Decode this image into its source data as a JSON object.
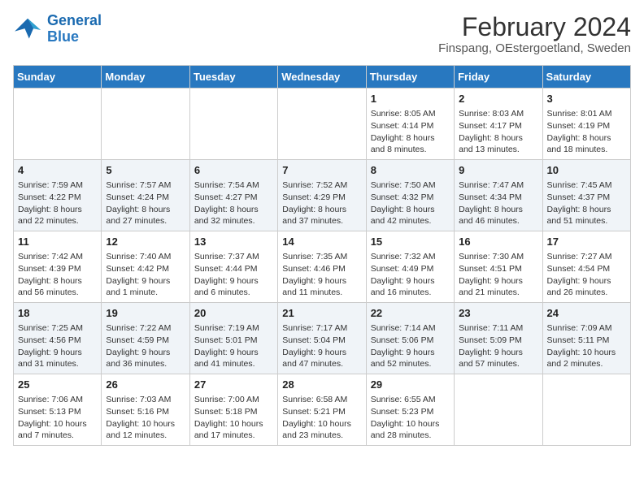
{
  "header": {
    "logo_line1": "General",
    "logo_line2": "Blue",
    "main_title": "February 2024",
    "subtitle": "Finspang, OEstergoetland, Sweden"
  },
  "days_of_week": [
    "Sunday",
    "Monday",
    "Tuesday",
    "Wednesday",
    "Thursday",
    "Friday",
    "Saturday"
  ],
  "weeks": [
    [
      {
        "day": "",
        "text": ""
      },
      {
        "day": "",
        "text": ""
      },
      {
        "day": "",
        "text": ""
      },
      {
        "day": "",
        "text": ""
      },
      {
        "day": "1",
        "text": "Sunrise: 8:05 AM\nSunset: 4:14 PM\nDaylight: 8 hours and 8 minutes."
      },
      {
        "day": "2",
        "text": "Sunrise: 8:03 AM\nSunset: 4:17 PM\nDaylight: 8 hours and 13 minutes."
      },
      {
        "day": "3",
        "text": "Sunrise: 8:01 AM\nSunset: 4:19 PM\nDaylight: 8 hours and 18 minutes."
      }
    ],
    [
      {
        "day": "4",
        "text": "Sunrise: 7:59 AM\nSunset: 4:22 PM\nDaylight: 8 hours and 22 minutes."
      },
      {
        "day": "5",
        "text": "Sunrise: 7:57 AM\nSunset: 4:24 PM\nDaylight: 8 hours and 27 minutes."
      },
      {
        "day": "6",
        "text": "Sunrise: 7:54 AM\nSunset: 4:27 PM\nDaylight: 8 hours and 32 minutes."
      },
      {
        "day": "7",
        "text": "Sunrise: 7:52 AM\nSunset: 4:29 PM\nDaylight: 8 hours and 37 minutes."
      },
      {
        "day": "8",
        "text": "Sunrise: 7:50 AM\nSunset: 4:32 PM\nDaylight: 8 hours and 42 minutes."
      },
      {
        "day": "9",
        "text": "Sunrise: 7:47 AM\nSunset: 4:34 PM\nDaylight: 8 hours and 46 minutes."
      },
      {
        "day": "10",
        "text": "Sunrise: 7:45 AM\nSunset: 4:37 PM\nDaylight: 8 hours and 51 minutes."
      }
    ],
    [
      {
        "day": "11",
        "text": "Sunrise: 7:42 AM\nSunset: 4:39 PM\nDaylight: 8 hours and 56 minutes."
      },
      {
        "day": "12",
        "text": "Sunrise: 7:40 AM\nSunset: 4:42 PM\nDaylight: 9 hours and 1 minute."
      },
      {
        "day": "13",
        "text": "Sunrise: 7:37 AM\nSunset: 4:44 PM\nDaylight: 9 hours and 6 minutes."
      },
      {
        "day": "14",
        "text": "Sunrise: 7:35 AM\nSunset: 4:46 PM\nDaylight: 9 hours and 11 minutes."
      },
      {
        "day": "15",
        "text": "Sunrise: 7:32 AM\nSunset: 4:49 PM\nDaylight: 9 hours and 16 minutes."
      },
      {
        "day": "16",
        "text": "Sunrise: 7:30 AM\nSunset: 4:51 PM\nDaylight: 9 hours and 21 minutes."
      },
      {
        "day": "17",
        "text": "Sunrise: 7:27 AM\nSunset: 4:54 PM\nDaylight: 9 hours and 26 minutes."
      }
    ],
    [
      {
        "day": "18",
        "text": "Sunrise: 7:25 AM\nSunset: 4:56 PM\nDaylight: 9 hours and 31 minutes."
      },
      {
        "day": "19",
        "text": "Sunrise: 7:22 AM\nSunset: 4:59 PM\nDaylight: 9 hours and 36 minutes."
      },
      {
        "day": "20",
        "text": "Sunrise: 7:19 AM\nSunset: 5:01 PM\nDaylight: 9 hours and 41 minutes."
      },
      {
        "day": "21",
        "text": "Sunrise: 7:17 AM\nSunset: 5:04 PM\nDaylight: 9 hours and 47 minutes."
      },
      {
        "day": "22",
        "text": "Sunrise: 7:14 AM\nSunset: 5:06 PM\nDaylight: 9 hours and 52 minutes."
      },
      {
        "day": "23",
        "text": "Sunrise: 7:11 AM\nSunset: 5:09 PM\nDaylight: 9 hours and 57 minutes."
      },
      {
        "day": "24",
        "text": "Sunrise: 7:09 AM\nSunset: 5:11 PM\nDaylight: 10 hours and 2 minutes."
      }
    ],
    [
      {
        "day": "25",
        "text": "Sunrise: 7:06 AM\nSunset: 5:13 PM\nDaylight: 10 hours and 7 minutes."
      },
      {
        "day": "26",
        "text": "Sunrise: 7:03 AM\nSunset: 5:16 PM\nDaylight: 10 hours and 12 minutes."
      },
      {
        "day": "27",
        "text": "Sunrise: 7:00 AM\nSunset: 5:18 PM\nDaylight: 10 hours and 17 minutes."
      },
      {
        "day": "28",
        "text": "Sunrise: 6:58 AM\nSunset: 5:21 PM\nDaylight: 10 hours and 23 minutes."
      },
      {
        "day": "29",
        "text": "Sunrise: 6:55 AM\nSunset: 5:23 PM\nDaylight: 10 hours and 28 minutes."
      },
      {
        "day": "",
        "text": ""
      },
      {
        "day": "",
        "text": ""
      }
    ]
  ]
}
